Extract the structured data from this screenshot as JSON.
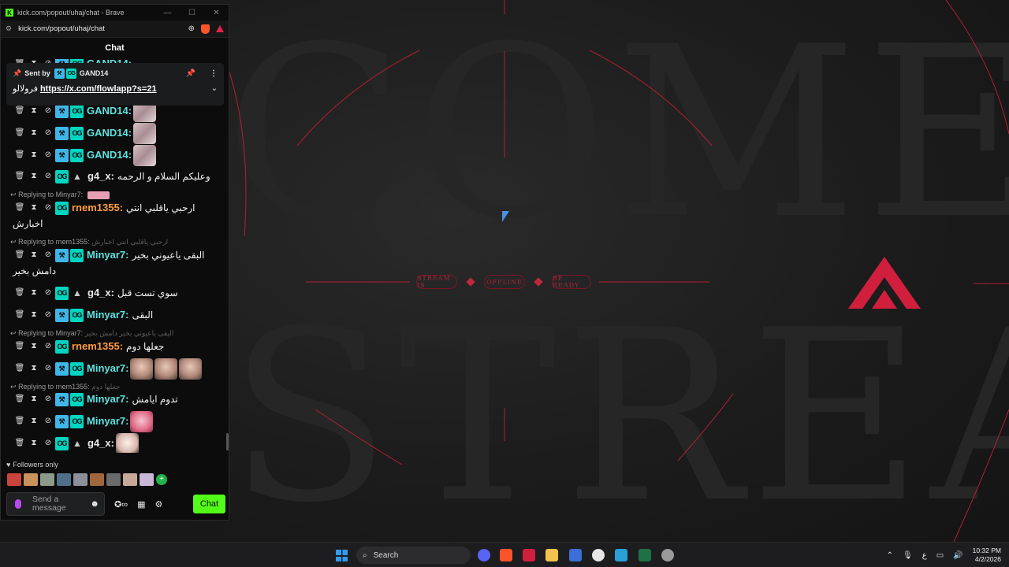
{
  "browser": {
    "title": "kick.com/popout/uhaj/chat - Brave",
    "url": "kick.com/popout/uhaj/chat",
    "win_min": "—",
    "win_max": "☐",
    "win_close": "✕"
  },
  "chat": {
    "header": "Chat",
    "pinned": {
      "sent_by_label": "Sent by",
      "sender": "GAND14",
      "text_prefix": "فرولالو",
      "link": "https://x.com/flowlapp?s=21"
    },
    "peek_top_user": "GAND14:",
    "messages": [
      {
        "user": "GAND14:",
        "text": ""
      },
      {
        "user": "GAND14:",
        "text": ""
      },
      {
        "user": "GAND14:",
        "text": ""
      },
      {
        "user": "g4_x:",
        "text": "وعليكم السلام و الرحمه"
      },
      {
        "reply": "Replying to Minyar7:",
        "user": "rnem1355:",
        "text": "ارحبي ياقلبي انتي",
        "text2": "اخبارش"
      },
      {
        "reply": "Replying to rnem1355:",
        "reply_ghost": "ارحبي ياقلبي انتي اخبارش",
        "user": "Minyar7:",
        "text": "البقى ياعيوني بخير",
        "text2": "دامش بخير"
      },
      {
        "user": "g4_x:",
        "text": "سوي تست قبل"
      },
      {
        "user": "Minyar7:",
        "text": "البقى"
      },
      {
        "reply": "Replying to Minyar7:",
        "reply_ghost": "البقى ياعيوني بخير دامش بخير",
        "user": "rnem1355:",
        "text": "جعلها دوم"
      },
      {
        "user": "Minyar7:",
        "text": ""
      },
      {
        "reply": "Replying to rnem1355:",
        "reply_ghost": "جعلها دوم",
        "user": "Minyar7:",
        "text": "تدوم ايامش"
      },
      {
        "user": "Minyar7:",
        "text": ""
      },
      {
        "user": "g4_x:",
        "text": ""
      }
    ],
    "followers_only": "Followers only",
    "input_placeholder": "Send a message",
    "chat_button": "Chat"
  },
  "overlay": {
    "word_top": "COME",
    "word_bottom": "STREA",
    "pill_1": "STREAM IS",
    "pill_2": "OFFLINE",
    "pill_3": "BE READY",
    "accent_color": "#c0283e"
  },
  "taskbar": {
    "search": "Search",
    "time": "10:32 PM",
    "date": "4/2/2026",
    "lang": "ع"
  }
}
